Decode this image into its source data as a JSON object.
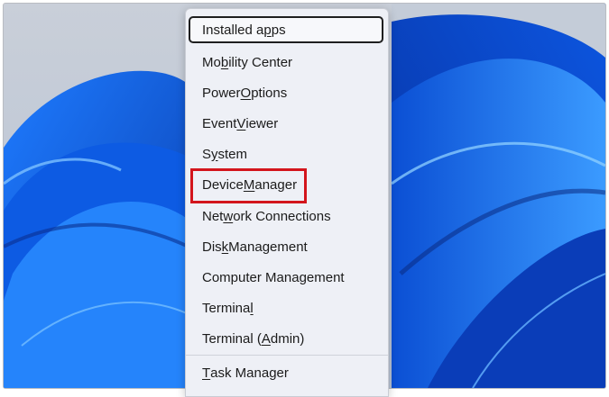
{
  "menu": {
    "items": [
      {
        "before": "Installed a",
        "key": "p",
        "after": "ps"
      },
      {
        "before": "Mo",
        "key": "b",
        "after": "ility Center"
      },
      {
        "before": "Power ",
        "key": "O",
        "after": "ptions"
      },
      {
        "before": "Event ",
        "key": "V",
        "after": "iewer"
      },
      {
        "before": "S",
        "key": "y",
        "after": "stem"
      },
      {
        "before": "Device ",
        "key": "M",
        "after": "anager"
      },
      {
        "before": "Net",
        "key": "w",
        "after": "ork Connections"
      },
      {
        "before": "Dis",
        "key": "k",
        "after": " Management"
      },
      {
        "before": "Computer Mana",
        "key": "g",
        "after": "ement"
      },
      {
        "before": "Termina",
        "key": "l",
        "after": ""
      },
      {
        "before": "Terminal (",
        "key": "A",
        "after": "dmin)"
      },
      {
        "before": "",
        "key": "T",
        "after": "ask Manager"
      }
    ],
    "focused_item": "Installed apps",
    "highlighted_item": "Device Manager"
  },
  "colors": {
    "highlight": "#d3151c",
    "wallpaper_blue": "#0a63e6",
    "menu_background": "#eef0f6"
  }
}
